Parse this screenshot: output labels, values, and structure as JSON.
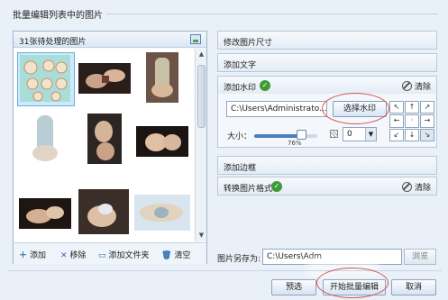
{
  "section_title": "批量编辑列表中的图片",
  "left_panel": {
    "header": "31张待处理的图片",
    "thumbnails": [
      {
        "name": "thumb-1",
        "selected": true,
        "palette": [
          "#9fd6d2",
          "#d8b69a",
          "#f2e1c8"
        ]
      },
      {
        "name": "thumb-2",
        "selected": false,
        "palette": [
          "#2a1e1a",
          "#caa38a",
          "#6d3a2c"
        ]
      },
      {
        "name": "thumb-3",
        "selected": false,
        "palette": [
          "#6b5446",
          "#d9b99b",
          "#c9c0a8"
        ]
      },
      {
        "name": "thumb-4",
        "selected": false,
        "palette": [
          "#a8c2c9",
          "#e1d5c8",
          "#ffffff"
        ]
      },
      {
        "name": "thumb-5",
        "selected": false,
        "palette": [
          "#2d2523",
          "#d4b49a",
          "#3a2d28"
        ]
      },
      {
        "name": "thumb-6",
        "selected": false,
        "palette": [
          "#1a1412",
          "#e0c0a4",
          "#2a1f1c"
        ]
      },
      {
        "name": "thumb-7",
        "selected": false,
        "palette": [
          "#1e1612",
          "#d3b093",
          "#302622"
        ]
      },
      {
        "name": "thumb-8",
        "selected": false,
        "palette": [
          "#3a2e28",
          "#dcbfa4",
          "#e8e8ee"
        ]
      },
      {
        "name": "thumb-9",
        "selected": false,
        "palette": [
          "#d8e4ee",
          "#e2d3bf",
          "#9fb0be"
        ]
      }
    ],
    "footer": {
      "add": "添加",
      "remove": "移除",
      "add_folder": "添加文件夹",
      "clear": "清空"
    }
  },
  "right_panel": {
    "resize": "修改图片尺寸",
    "add_text": "添加文字",
    "watermark": {
      "label": "添加水印",
      "clear": "清除",
      "path": "C:\\Users\\Administrato...",
      "pick_button": "选择水印",
      "size_label": "大小：",
      "size_percent": "76%",
      "size_value": 0.76,
      "opacity_value": "0",
      "position_grid": [
        "↖",
        "↑",
        "↗",
        "←",
        "·",
        "→",
        "↙",
        "↓",
        "↘"
      ]
    },
    "border": "添加边框",
    "format": {
      "label": "转换图片格式",
      "clear": "清除"
    }
  },
  "output": {
    "label": "图片另存为:",
    "path": "C:\\Users\\Adm",
    "browse": "浏览"
  },
  "buttons": {
    "preview": "预选",
    "start": "开始批量编辑",
    "cancel": "取消"
  },
  "colors": {
    "accent": "#2d6db3",
    "check": "#3e9a35",
    "annotation": "#d9534f"
  }
}
